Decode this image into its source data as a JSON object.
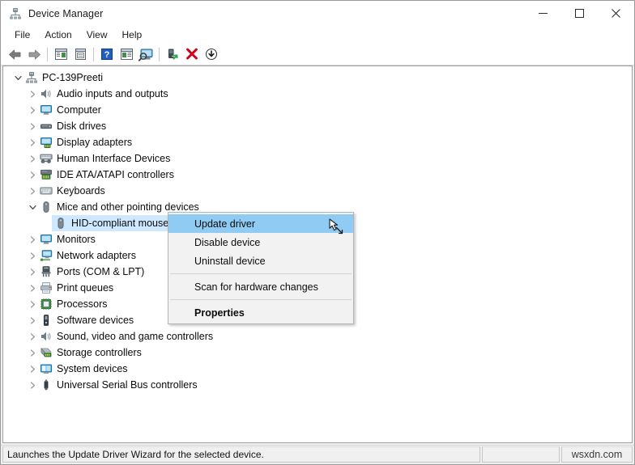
{
  "window": {
    "title": "Device Manager",
    "icon": "device-manager-icon",
    "buttons": {
      "minimize": "—",
      "maximize": "☐",
      "close": "✕"
    }
  },
  "menubar": {
    "items": [
      {
        "label": "File"
      },
      {
        "label": "Action"
      },
      {
        "label": "View"
      },
      {
        "label": "Help"
      }
    ]
  },
  "toolbar": {
    "buttons": [
      {
        "name": "back-icon",
        "type": "icon"
      },
      {
        "name": "forward-icon",
        "type": "icon"
      },
      {
        "name": "separator",
        "type": "separator"
      },
      {
        "name": "show-hide-console-tree-icon",
        "type": "icon"
      },
      {
        "name": "properties-icon",
        "type": "icon"
      },
      {
        "name": "separator",
        "type": "separator"
      },
      {
        "name": "help-icon",
        "type": "icon"
      },
      {
        "name": "show-action-pane-icon",
        "type": "icon"
      },
      {
        "name": "scan-for-hardware-changes-icon",
        "type": "icon"
      },
      {
        "name": "separator",
        "type": "separator"
      },
      {
        "name": "update-driver-icon",
        "type": "icon"
      },
      {
        "name": "uninstall-device-icon",
        "type": "icon"
      },
      {
        "name": "disable-device-icon",
        "type": "icon"
      }
    ]
  },
  "tree": {
    "nodes": [
      {
        "label": "PC-139Preeti",
        "indent": 0,
        "expander": "expanded",
        "icon": "computer-root-icon",
        "selected": false
      },
      {
        "label": "Audio inputs and outputs",
        "indent": 1,
        "expander": "collapsed",
        "icon": "speaker-icon",
        "selected": false
      },
      {
        "label": "Computer",
        "indent": 1,
        "expander": "collapsed",
        "icon": "monitor-icon",
        "selected": false
      },
      {
        "label": "Disk drives",
        "indent": 1,
        "expander": "collapsed",
        "icon": "disk-drive-icon",
        "selected": false
      },
      {
        "label": "Display adapters",
        "indent": 1,
        "expander": "collapsed",
        "icon": "display-adapter-icon",
        "selected": false
      },
      {
        "label": "Human Interface Devices",
        "indent": 1,
        "expander": "collapsed",
        "icon": "hid-icon",
        "selected": false
      },
      {
        "label": "IDE ATA/ATAPI controllers",
        "indent": 1,
        "expander": "collapsed",
        "icon": "ide-controller-icon",
        "selected": false
      },
      {
        "label": "Keyboards",
        "indent": 1,
        "expander": "collapsed",
        "icon": "keyboard-icon",
        "selected": false
      },
      {
        "label": "Mice and other pointing devices",
        "indent": 1,
        "expander": "expanded",
        "icon": "mouse-icon",
        "selected": false
      },
      {
        "label": "HID-compliant mouse",
        "indent": 2,
        "expander": "none",
        "icon": "mouse-icon",
        "selected": true
      },
      {
        "label": "Monitors",
        "indent": 1,
        "expander": "collapsed",
        "icon": "monitor-icon",
        "selected": false
      },
      {
        "label": "Network adapters",
        "indent": 1,
        "expander": "collapsed",
        "icon": "network-adapter-icon",
        "selected": false
      },
      {
        "label": "Ports (COM & LPT)",
        "indent": 1,
        "expander": "collapsed",
        "icon": "port-icon",
        "selected": false
      },
      {
        "label": "Print queues",
        "indent": 1,
        "expander": "collapsed",
        "icon": "printer-icon",
        "selected": false
      },
      {
        "label": "Processors",
        "indent": 1,
        "expander": "collapsed",
        "icon": "processor-icon",
        "selected": false
      },
      {
        "label": "Software devices",
        "indent": 1,
        "expander": "collapsed",
        "icon": "software-device-icon",
        "selected": false
      },
      {
        "label": "Sound, video and game controllers",
        "indent": 1,
        "expander": "collapsed",
        "icon": "speaker-icon",
        "selected": false
      },
      {
        "label": "Storage controllers",
        "indent": 1,
        "expander": "collapsed",
        "icon": "storage-controller-icon",
        "selected": false
      },
      {
        "label": "System devices",
        "indent": 1,
        "expander": "collapsed",
        "icon": "system-device-icon",
        "selected": false
      },
      {
        "label": "Universal Serial Bus controllers",
        "indent": 1,
        "expander": "collapsed",
        "icon": "usb-icon",
        "selected": false
      }
    ]
  },
  "context_menu": {
    "items": [
      {
        "label": "Update driver",
        "highlighted": true,
        "bold": false,
        "type": "item"
      },
      {
        "label": "Disable device",
        "highlighted": false,
        "bold": false,
        "type": "item"
      },
      {
        "label": "Uninstall device",
        "highlighted": false,
        "bold": false,
        "type": "item"
      },
      {
        "label": "",
        "type": "separator"
      },
      {
        "label": "Scan for hardware changes",
        "highlighted": false,
        "bold": false,
        "type": "item"
      },
      {
        "label": "",
        "type": "separator"
      },
      {
        "label": "Properties",
        "highlighted": false,
        "bold": true,
        "type": "item"
      }
    ]
  },
  "statusbar": {
    "message": "Launches the Update Driver Wizard for the selected device.",
    "middle": "",
    "watermark": "wsxdn.com"
  },
  "colors": {
    "selection": "#cde8ff",
    "menu_highlight": "#8fcbf3",
    "window_bg": "#f0f0f0"
  }
}
